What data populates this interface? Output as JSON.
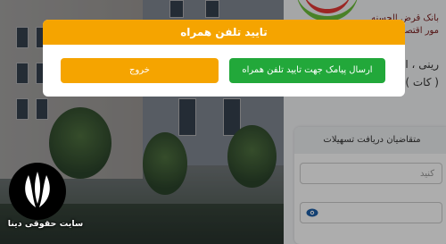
{
  "page": {
    "header_line1": "بانک قرض الحسنه",
    "header_line2": "مور اقتصادی",
    "sub_line1": "رینی ، اش",
    "sub_line2": "( کات )",
    "card_title": "متقاضیان دریافت تسهیلات",
    "username_placeholder": "کنید",
    "password_icon": "eye-icon"
  },
  "modal": {
    "title": "تایید تلفن همراه",
    "confirm_label": "ارسال پیامک جهت تایید تلفن همراه",
    "exit_label": "خروج"
  },
  "watermark": {
    "text": "سایت حقوقی دینا",
    "logo": "dina-logo"
  },
  "colors": {
    "modal_header": "#f5a400",
    "confirm_button": "#22a83a",
    "exit_button": "#f5a400"
  }
}
